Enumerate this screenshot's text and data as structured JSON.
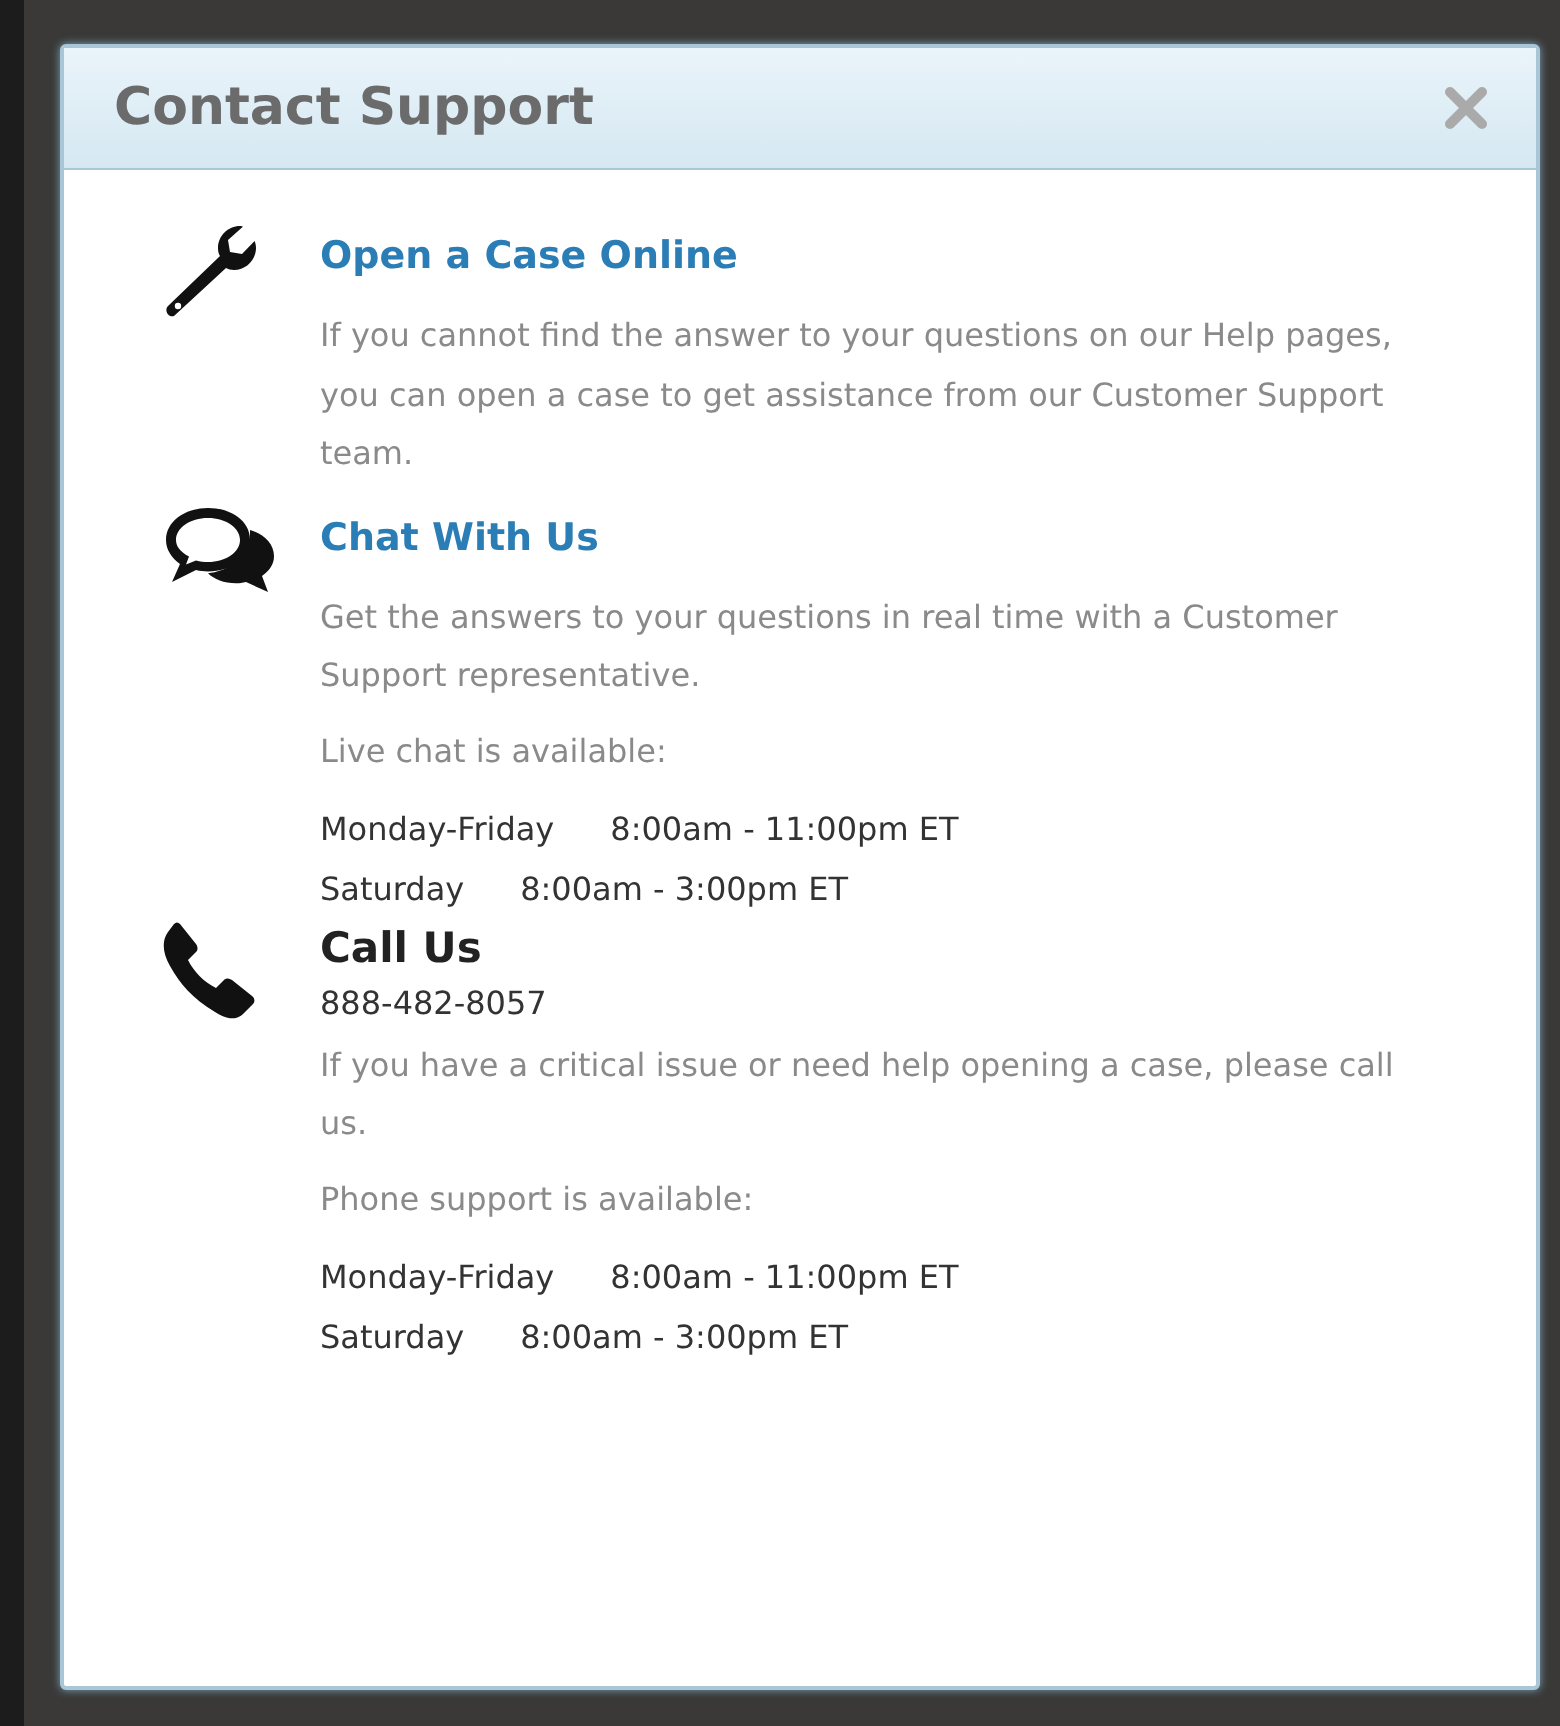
{
  "dialog": {
    "title": "Contact Support"
  },
  "sections": [
    {
      "kind": "link",
      "heading": "Open a Case Online",
      "paragraphs": [
        "If you cannot find the answer to your questions on our Help pages, you can open a case to get assistance from our Customer Support team."
      ]
    },
    {
      "kind": "link",
      "heading": "Chat With Us",
      "paragraphs": [
        "Get the answers to your questions in real time with a Customer Support representative."
      ],
      "availability": "Live chat is available:",
      "schedule": [
        {
          "days": "Monday-Friday",
          "hours": "8:00am - 11:00pm ET"
        },
        {
          "days": "Saturday",
          "hours": "8:00am - 3:00pm ET"
        }
      ]
    },
    {
      "kind": "plain",
      "heading": "Call Us",
      "phone": "888-482-8057",
      "paragraphs": [
        "If you have a critical issue or need help opening a case, please call us."
      ],
      "availability": "Phone support is available:",
      "schedule": [
        {
          "days": "Monday-Friday",
          "hours": "8:00am - 11:00pm ET"
        },
        {
          "days": "Saturday",
          "hours": "8:00am - 3:00pm ET"
        }
      ]
    }
  ]
}
